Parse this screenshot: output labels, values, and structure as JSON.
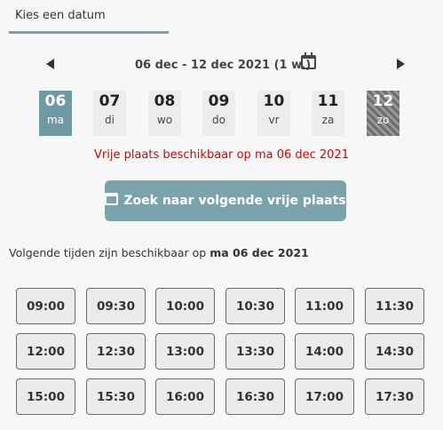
{
  "tab": {
    "label": "Kies een datum"
  },
  "week": {
    "range": "06 dec - 12 dec 2021 (1 w.)",
    "days": [
      {
        "num": "06",
        "wd": "ma",
        "state": "selected"
      },
      {
        "num": "07",
        "wd": "di",
        "state": "normal"
      },
      {
        "num": "08",
        "wd": "wo",
        "state": "normal"
      },
      {
        "num": "09",
        "wd": "do",
        "state": "normal"
      },
      {
        "num": "10",
        "wd": "vr",
        "state": "normal"
      },
      {
        "num": "11",
        "wd": "za",
        "state": "normal"
      },
      {
        "num": "12",
        "wd": "zo",
        "state": "disabled"
      }
    ]
  },
  "availability_message": "Vrije plaats beschikbaar op ma 06 dec 2021",
  "search_button": {
    "label": "Zoek naar volgende vrije plaats"
  },
  "times_label": {
    "prefix": "Volgende tijden zijn beschikbaar op ",
    "date": "ma 06 dec 2021"
  },
  "slots": [
    "09:00",
    "09:30",
    "10:00",
    "10:30",
    "11:00",
    "11:30",
    "12:00",
    "12:30",
    "13:00",
    "13:30",
    "14:00",
    "14:30",
    "15:00",
    "15:30",
    "16:00",
    "16:30",
    "17:00",
    "17:30"
  ],
  "colors": {
    "accent": "#7aa3ab",
    "selected_day": "#6f9aa4",
    "message": "#d40000"
  }
}
